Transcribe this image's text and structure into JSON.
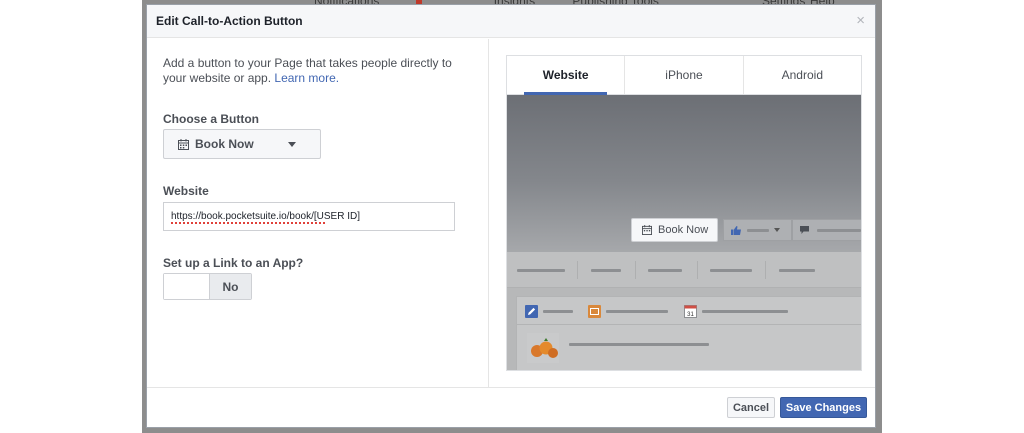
{
  "background": {
    "tabs": [
      "Notifications",
      "Insights",
      "Publishing Tools"
    ],
    "right_items": [
      "Settings",
      "Help"
    ]
  },
  "modal": {
    "title": "Edit Call-to-Action Button",
    "close_glyph": "×"
  },
  "form": {
    "intro_text": "Add a button to your Page that takes people directly to your website or app.",
    "learn_more": "Learn more.",
    "choose_button_label": "Choose a Button",
    "selected_button": "Book Now",
    "website_label": "Website",
    "website_value": "https://book.pocketsuite.io/book/[USER ID]",
    "app_link_label": "Set up a Link to an App?",
    "app_link_toggle": "No"
  },
  "preview": {
    "tabs": [
      {
        "label": "Website",
        "active": true
      },
      {
        "label": "iPhone",
        "active": false
      },
      {
        "label": "Android",
        "active": false
      }
    ],
    "cta_label": "Book Now",
    "calendar_day": "31"
  },
  "footer": {
    "cancel_label": "Cancel",
    "save_label": "Save Changes"
  },
  "colors": {
    "accent": "#4267b2",
    "header_bg": "#f6f7f9",
    "text": "#4b4f56"
  }
}
